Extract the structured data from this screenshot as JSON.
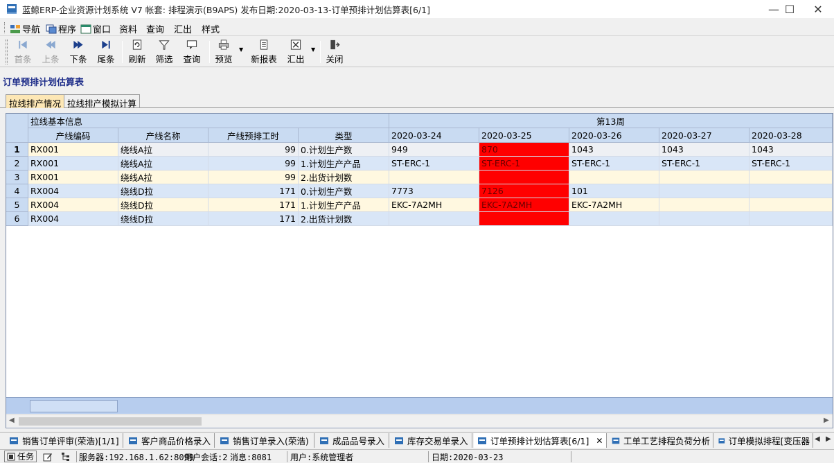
{
  "window": {
    "title": "蓝鲸ERP-企业资源计划系统 V7 帐套: 排程演示(B9APS) 发布日期:2020-03-13-订单预排计划估算表[6/1]",
    "minimize": "—",
    "maximize": "☐",
    "close": "✕"
  },
  "menu": [
    {
      "label": "导航",
      "icon": "navigation-icon"
    },
    {
      "label": "程序",
      "icon": "program-icon"
    },
    {
      "label": "窗口",
      "icon": "window-icon"
    },
    {
      "label": "资料"
    },
    {
      "label": "查询"
    },
    {
      "label": "汇出"
    },
    {
      "label": "样式"
    }
  ],
  "toolbar": {
    "first": "首条",
    "prev": "上条",
    "next": "下条",
    "last": "尾条",
    "refresh": "刷新",
    "filter": "筛选",
    "query": "查询",
    "preview": "预览",
    "new_report": "新报表",
    "export": "汇出",
    "close": "关闭"
  },
  "page_title": "订单预排计划估算表",
  "tabs": [
    "拉线排产情况",
    "拉线排产模拟计算"
  ],
  "grid": {
    "group_basic": "拉线基本信息",
    "group_week": "第13周",
    "columns": [
      "产线编码",
      "产线名称",
      "产线预排工时",
      "类型"
    ],
    "dates": [
      "2020-03-24",
      "2020-03-25",
      "2020-03-26",
      "2020-03-27",
      "2020-03-28"
    ],
    "rows": [
      {
        "no": "1",
        "code": "RX001",
        "name": "绕线A拉",
        "hours": "99",
        "type": "0.计划生产数",
        "d": [
          "949",
          "870",
          "1043",
          "1043",
          "1043"
        ]
      },
      {
        "no": "2",
        "code": "RX001",
        "name": "绕线A拉",
        "hours": "99",
        "type": "1.计划生产产品",
        "d": [
          "ST-ERC-1",
          "ST-ERC-1",
          "ST-ERC-1",
          "ST-ERC-1",
          "ST-ERC-1"
        ]
      },
      {
        "no": "3",
        "code": "RX001",
        "name": "绕线A拉",
        "hours": "99",
        "type": "2.出货计划数",
        "d": [
          "",
          "",
          "",
          "",
          ""
        ]
      },
      {
        "no": "4",
        "code": "RX004",
        "name": "绕线D拉",
        "hours": "171",
        "type": "0.计划生产数",
        "d": [
          "7773",
          "7126",
          "101",
          "",
          ""
        ]
      },
      {
        "no": "5",
        "code": "RX004",
        "name": "绕线D拉",
        "hours": "171",
        "type": "1.计划生产产品",
        "d": [
          "EKC-7A2MH",
          "EKC-7A2MH",
          "EKC-7A2MH",
          "",
          ""
        ]
      },
      {
        "no": "6",
        "code": "RX004",
        "name": "绕线D拉",
        "hours": "171",
        "type": "2.出货计划数",
        "d": [
          "",
          "",
          "",
          "",
          ""
        ]
      }
    ],
    "highlight_color": "#ff0000"
  },
  "doc_tabs": [
    "销售订单评审(荣浩)[1/1]",
    "客户商品价格录入",
    "销售订单录入(荣浩)",
    "成品品号录入",
    "库存交易单录入",
    "订单预排计划估算表[6/1]",
    "工单工艺排程负荷分析",
    "订单模拟排程[变压器"
  ],
  "doc_tab_close": "✕",
  "status": {
    "task": "任务",
    "server": "服务器:192.168.1.62:8099",
    "sessions": "用户会话:2",
    "messages": "消息:8081",
    "user": "用户:系统管理者",
    "date": "日期:2020-03-23"
  }
}
